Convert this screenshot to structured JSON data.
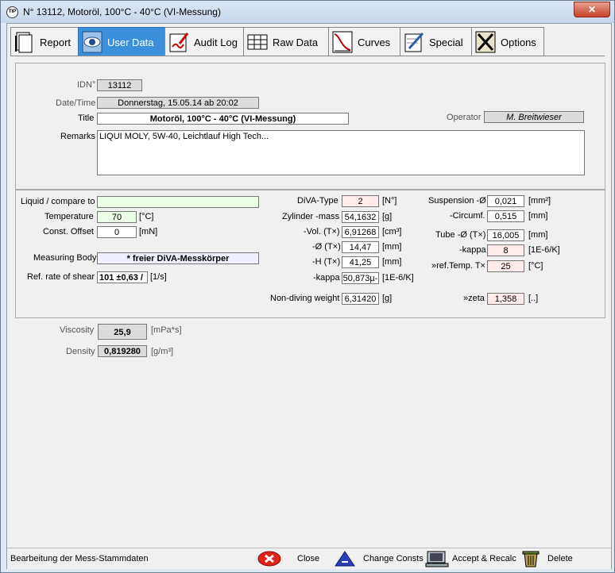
{
  "window": {
    "title": "N° 13112,  Motoröl, 100°C - 40°C (VI-Messung)",
    "close_glyph": "✕"
  },
  "tabs": [
    {
      "label": "Report"
    },
    {
      "label": "User Data"
    },
    {
      "label": "Audit Log"
    },
    {
      "label": "Raw Data"
    },
    {
      "label": "Curves"
    },
    {
      "label": "Special"
    },
    {
      "label": "Options"
    }
  ],
  "header": {
    "idn_label": "IDN°",
    "idn_value": "13112",
    "datetime_label": "Date/Time",
    "datetime_value": "Donnerstag, 15.05.14 ab 20:02",
    "title_label": "Title",
    "title_value": "Motoröl, 100°C - 40°C (VI-Messung)",
    "operator_label": "Operator",
    "operator_value": "M. Breitwieser",
    "remarks_label": "Remarks",
    "remarks_value": "LIQUI MOLY, 5W-40, Leichtlauf High Tech..."
  },
  "params": {
    "liquid_label": "Liquid / compare to",
    "liquid_value": "",
    "temperature_label": "Temperature",
    "temperature_value": "70",
    "temperature_unit": "[°C]",
    "offset_label": "Const. Offset",
    "offset_value": "0",
    "offset_unit": "[mN]",
    "body_label": "Measuring Body",
    "body_value": "* freier DiVA-Messkörper",
    "shear_label": "Ref. rate of shear",
    "shear_value": "101 ±0,63 /",
    "shear_unit": "[1/s]",
    "diva_type_label": "DiVA-Type",
    "diva_type_value": "2",
    "diva_type_unit": "[N°]",
    "zyl_mass_label": "Zylinder -mass",
    "zyl_mass_value": "54,1632",
    "zyl_mass_unit": "[g]",
    "vol_label": "-Vol. (T×)",
    "vol_value": "6,91268",
    "vol_unit": "[cm³]",
    "dia_label": "-Ø (T×)",
    "dia_value": "14,47",
    "dia_unit": "[mm]",
    "h_label": "-H (T×)",
    "h_value": "41,25",
    "h_unit": "[mm]",
    "kappa1_label": "-kappa",
    "kappa1_value": "50,873µ-",
    "kappa1_unit": "[1E-6/K]",
    "nondiving_label": "Non-diving weight",
    "nondiving_value": "6,31420",
    "nondiving_unit": "[g]",
    "susp_label": "Suspension -Ø",
    "susp_value": "0,021",
    "susp_unit": "[mm²]",
    "circ_label": "-Circumf.",
    "circ_value": "0,515",
    "circ_unit": "[mm]",
    "tube_label": "Tube -Ø (T×)",
    "tube_value": "16,005",
    "tube_unit": "[mm]",
    "kappa2_label": "-kappa",
    "kappa2_value": "8",
    "kappa2_unit": "[1E-6/K]",
    "reftemp_label": "»ref.Temp. T×",
    "reftemp_value": "25",
    "reftemp_unit": "[°C]",
    "zeta_label": "»zeta",
    "zeta_value": "1,358",
    "zeta_unit": "[..]"
  },
  "results": {
    "viscosity_label": "Viscosity",
    "viscosity_value": "25,9",
    "viscosity_unit": "[mPa*s]",
    "density_label": "Density",
    "density_value": "0,819280",
    "density_unit": "[g/m³]"
  },
  "status": {
    "text": "Bearbeitung der Mess-Stammdaten",
    "close": "Close",
    "change": "Change Consts",
    "accept": "Accept & Recalc",
    "delete": "Delete"
  },
  "colors": {
    "active_tab": "#3b8fdb",
    "field_green": "#eaffe6",
    "field_pink": "#ffecea",
    "close_red": "#e0231b"
  }
}
